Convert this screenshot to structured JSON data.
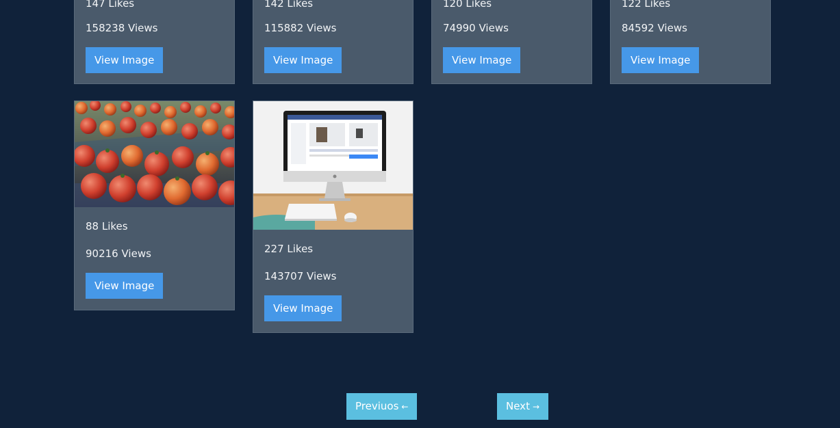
{
  "cards_top": [
    {
      "likes": "147 Likes",
      "views": "158238 Views",
      "button": "View Image"
    },
    {
      "likes": "142 Likes",
      "views": "115882 Views",
      "button": "View Image"
    },
    {
      "likes": "120 Likes",
      "views": "74990 Views",
      "button": "View Image"
    },
    {
      "likes": "122 Likes",
      "views": "84592 Views",
      "button": "View Image"
    }
  ],
  "cards_bottom": [
    {
      "image": "tomatoes-photo",
      "likes": "88 Likes",
      "views": "90216 Views",
      "button": "View Image"
    },
    {
      "image": "computer-desk-photo",
      "likes": "227 Likes",
      "views": "143707 Views",
      "button": "View Image"
    }
  ],
  "pagination": {
    "previous_label": "Previuos",
    "previous_arrow": "←",
    "next_label": "Next",
    "next_arrow": "→"
  },
  "colors": {
    "background": "#10223a",
    "card": "#4a5a6b",
    "button": "#4698e8",
    "pager_button": "#5bbfe0"
  }
}
